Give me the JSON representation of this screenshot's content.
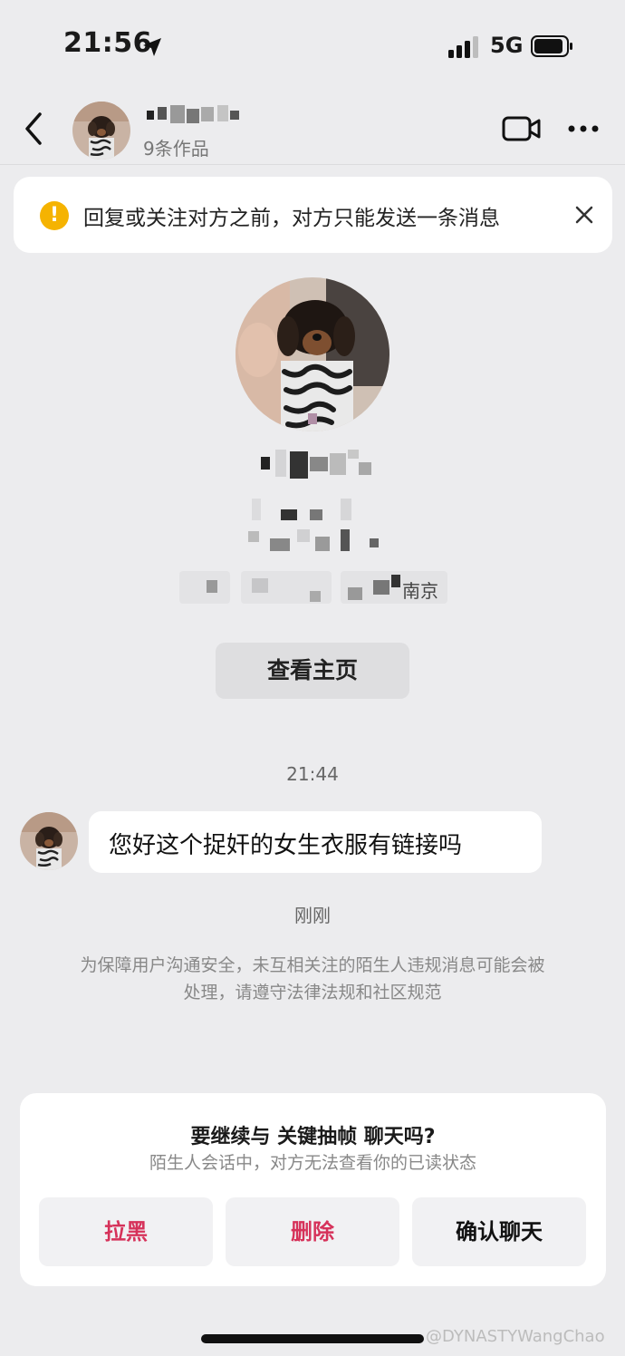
{
  "status_bar": {
    "time": "21:56",
    "network": "5G",
    "icons": [
      "location-arrow-icon",
      "signal-bars-icon",
      "battery-icon"
    ]
  },
  "header": {
    "works_count": "9条作品",
    "icons": [
      "back-chevron-icon",
      "video-camera-icon",
      "more-dots-icon"
    ]
  },
  "notice": {
    "text": "回复或关注对方之前，对方只能发送一条消息",
    "icon": "warning-circle-icon",
    "close_icon": "close-icon",
    "color": "#f5b301"
  },
  "profile": {
    "city": "南京",
    "view_homepage_label": "查看主页"
  },
  "chat": {
    "timestamp": "21:44",
    "message": "您好这个捉奸的女生衣服有链接吗",
    "sent_time": "刚刚",
    "safety_note": "为保障用户沟通安全，未互相关注的陌生人违规消息可能会被处理，请遵守法律法规和社区规范"
  },
  "dialog": {
    "title": "要继续与 关键抽帧 聊天吗?",
    "subtitle": "陌生人会话中，对方无法查看你的已读状态",
    "buttons": {
      "block": "拉黑",
      "delete": "删除",
      "confirm": "确认聊天"
    },
    "accent_color": "#d6325a"
  },
  "watermark": "@DYNASTYWangChao"
}
